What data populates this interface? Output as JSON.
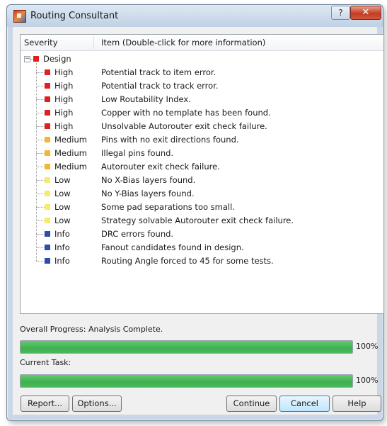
{
  "window": {
    "title": "Routing Consultant",
    "help_glyph": "?",
    "close_glyph": "✕"
  },
  "list": {
    "columns": [
      "Severity",
      "Item (Double-click for more information)"
    ],
    "root": {
      "label": "Design",
      "expander": "−",
      "color": "#e02020"
    },
    "rows": [
      {
        "severity": "High",
        "item": "Potential track to item error.",
        "color": "#e02020"
      },
      {
        "severity": "High",
        "item": "Potential track to track error.",
        "color": "#e02020"
      },
      {
        "severity": "High",
        "item": "Low Routability Index.",
        "color": "#e02020"
      },
      {
        "severity": "High",
        "item": "Copper with no template has been found.",
        "color": "#e02020"
      },
      {
        "severity": "High",
        "item": "Unsolvable Autorouter exit check failure.",
        "color": "#e02020"
      },
      {
        "severity": "Medium",
        "item": "Pins with no exit directions found.",
        "color": "#f5b733"
      },
      {
        "severity": "Medium",
        "item": "Illegal pins found.",
        "color": "#f5b733"
      },
      {
        "severity": "Medium",
        "item": "Autorouter exit check failure.",
        "color": "#f5b733"
      },
      {
        "severity": "Low",
        "item": "No X-Bias layers found.",
        "color": "#f6ec6a"
      },
      {
        "severity": "Low",
        "item": "No Y-Bias layers found.",
        "color": "#f6ec6a"
      },
      {
        "severity": "Low",
        "item": "Some pad separations too small.",
        "color": "#f6ec6a"
      },
      {
        "severity": "Low",
        "item": "Strategy solvable Autorouter exit check failure.",
        "color": "#f6ec6a"
      },
      {
        "severity": "Info",
        "item": "DRC errors found.",
        "color": "#2b4fae"
      },
      {
        "severity": "Info",
        "item": "Fanout candidates found in design.",
        "color": "#2b4fae"
      },
      {
        "severity": "Info",
        "item": "Routing Angle forced to 45 for some tests.",
        "color": "#2b4fae"
      }
    ]
  },
  "progress": {
    "overall_label": "Overall Progress: Analysis Complete.",
    "overall_percent_text": "100%",
    "overall_fraction": 1.0,
    "task_label": "Current Task:",
    "task_percent_text": "100%",
    "task_fraction": 1.0
  },
  "buttons": {
    "report": "Report...",
    "options": "Options...",
    "continue": "Continue",
    "cancel": "Cancel",
    "help": "Help"
  }
}
